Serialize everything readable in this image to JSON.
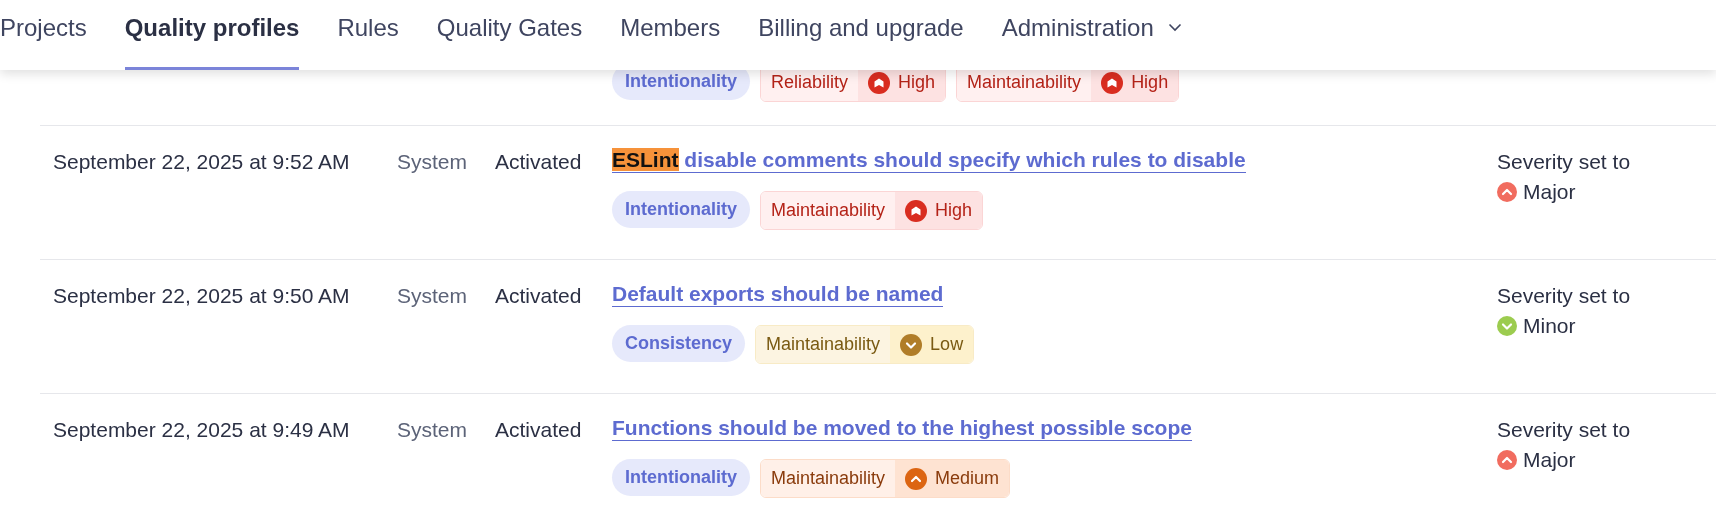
{
  "nav": {
    "items": [
      {
        "label": "Projects",
        "selected": false,
        "dropdown": false
      },
      {
        "label": "Quality profiles",
        "selected": true,
        "dropdown": false
      },
      {
        "label": "Rules",
        "selected": false,
        "dropdown": false
      },
      {
        "label": "Quality Gates",
        "selected": false,
        "dropdown": false
      },
      {
        "label": "Members",
        "selected": false,
        "dropdown": false
      },
      {
        "label": "Billing and upgrade",
        "selected": false,
        "dropdown": false
      },
      {
        "label": "Administration",
        "selected": false,
        "dropdown": true
      }
    ]
  },
  "changelog": {
    "rows": [
      {
        "kind": "partial",
        "tag": {
          "label": "Intentionality"
        },
        "impacts": [
          {
            "quality": "Reliability",
            "level": "High",
            "kind": "high"
          },
          {
            "quality": "Maintainability",
            "level": "High",
            "kind": "high"
          }
        ]
      },
      {
        "kind": "entry",
        "date": "September 22, 2025 at 9:52 AM",
        "user": "System",
        "action": "Activated",
        "title_parts": [
          {
            "text": "ESLint",
            "highlighted": true
          },
          {
            "text": " disable comments should specify which rules to disable",
            "highlighted": false
          }
        ],
        "tag": {
          "label": "Intentionality"
        },
        "impacts": [
          {
            "quality": "Maintainability",
            "level": "High",
            "kind": "high"
          }
        ],
        "change": {
          "label": "Severity set to",
          "value": "Major",
          "kind": "major"
        }
      },
      {
        "kind": "entry",
        "date": "September 22, 2025 at 9:50 AM",
        "user": "System",
        "action": "Activated",
        "title_parts": [
          {
            "text": "Default exports should be named",
            "highlighted": false
          }
        ],
        "tag": {
          "label": "Consistency"
        },
        "impacts": [
          {
            "quality": "Maintainability",
            "level": "Low",
            "kind": "low"
          }
        ],
        "change": {
          "label": "Severity set to",
          "value": "Minor",
          "kind": "minor"
        }
      },
      {
        "kind": "entry",
        "date": "September 22, 2025 at 9:49 AM",
        "user": "System",
        "action": "Activated",
        "title_parts": [
          {
            "text": "Functions should be moved to the highest possible scope",
            "highlighted": false
          }
        ],
        "tag": {
          "label": "Intentionality"
        },
        "impacts": [
          {
            "quality": "Maintainability",
            "level": "Medium",
            "kind": "medium"
          }
        ],
        "change": {
          "label": "Severity set to",
          "value": "Major",
          "kind": "major"
        }
      }
    ]
  }
}
